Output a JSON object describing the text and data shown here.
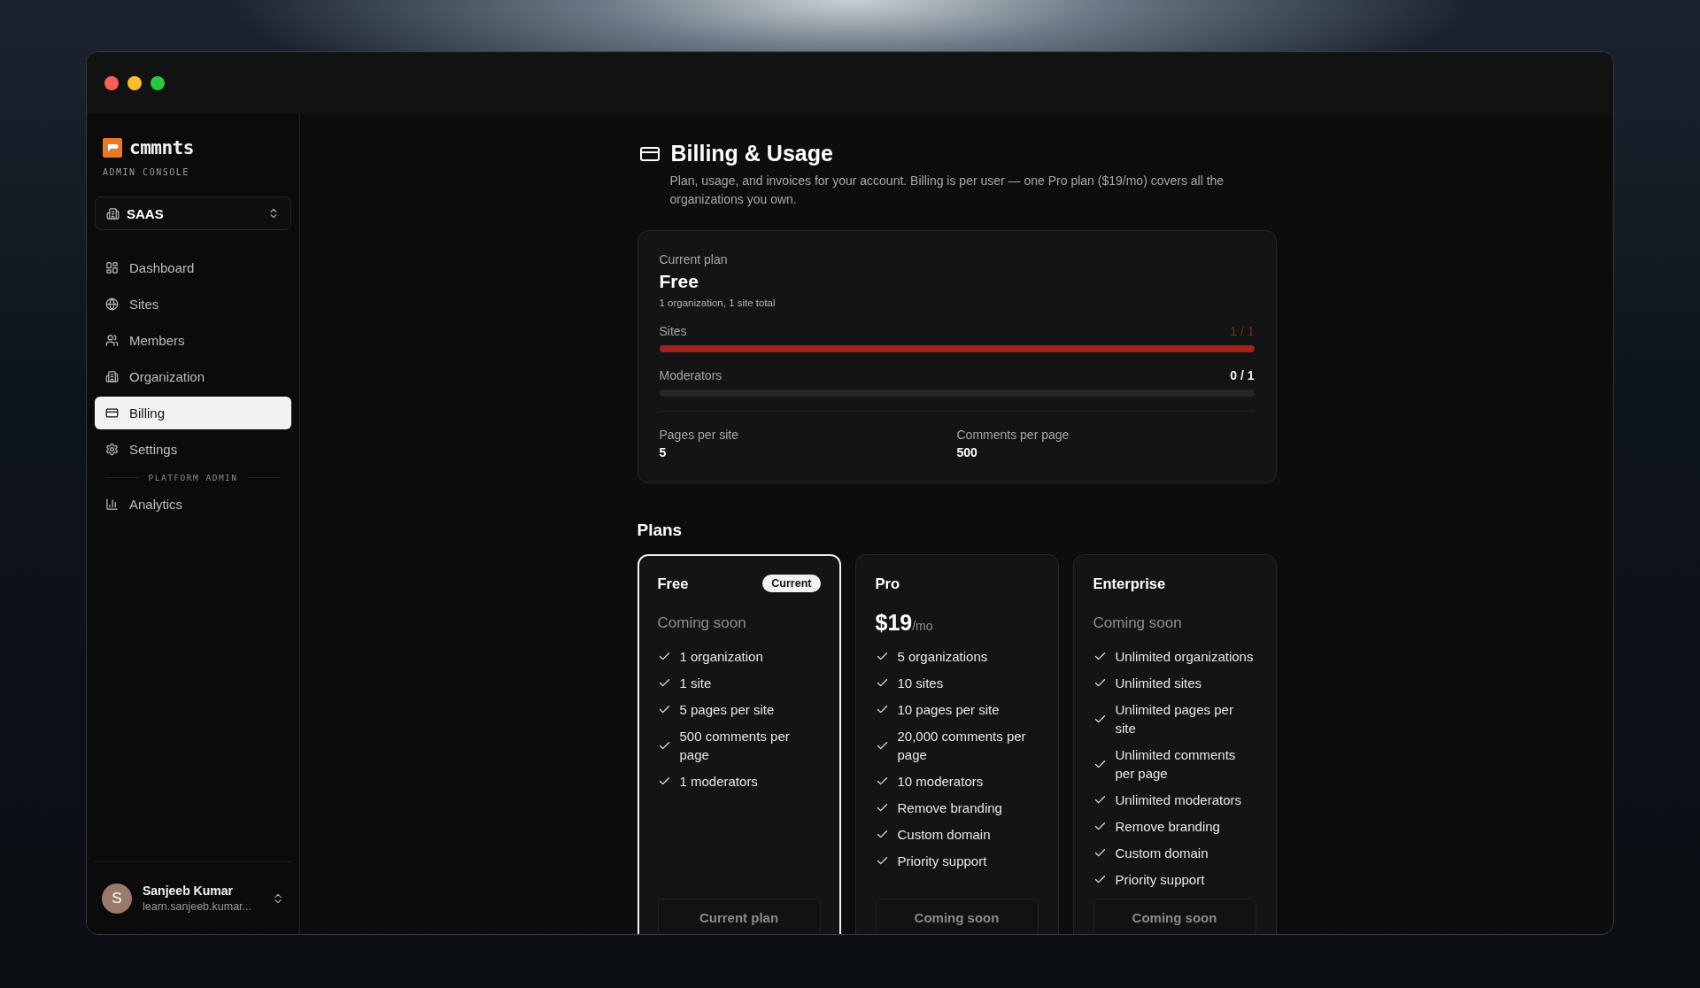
{
  "brand": {
    "name": "cmmnts",
    "subtitle": "ADMIN CONSOLE"
  },
  "org_switcher": {
    "value": "SAAS"
  },
  "sidebar": {
    "nav": [
      {
        "label": "Dashboard",
        "selected": false
      },
      {
        "label": "Sites",
        "selected": false
      },
      {
        "label": "Members",
        "selected": false
      },
      {
        "label": "Organization",
        "selected": false
      },
      {
        "label": "Billing",
        "selected": true
      },
      {
        "label": "Settings",
        "selected": false
      }
    ],
    "section": "PLATFORM ADMIN",
    "admin_nav": [
      {
        "label": "Analytics",
        "selected": false
      }
    ]
  },
  "user": {
    "initial": "S",
    "name": "Sanjeeb Kumar",
    "email": "learn.sanjeeb.kumar..."
  },
  "page": {
    "title": "Billing & Usage",
    "description": "Plan, usage, and invoices for your account. Billing is per user — one Pro plan ($19/mo) covers all the organizations you own."
  },
  "usage": {
    "label": "Current plan",
    "plan": "Free",
    "summary": "1 organization, 1 site total",
    "meters": [
      {
        "name": "Sites",
        "reading": "1 / 1",
        "level": 1,
        "at_limit": true
      },
      {
        "name": "Moderators",
        "reading": "0 / 1",
        "level": 0,
        "at_limit": false
      }
    ],
    "limits": [
      {
        "label": "Pages per site",
        "value": "5"
      },
      {
        "label": "Comments per page",
        "value": "500"
      }
    ]
  },
  "plans_title": "Plans",
  "plans": [
    {
      "name": "Free",
      "current": true,
      "badge": "Current",
      "price_note": "Coming soon",
      "features": [
        "1 organization",
        "1 site",
        "5 pages per site",
        "500 comments per page",
        "1 moderators"
      ],
      "button": {
        "label": "Current plan",
        "disabled": true
      }
    },
    {
      "name": "Pro",
      "current": false,
      "price": {
        "amount": "$19",
        "unit": "/mo"
      },
      "features": [
        "5 organizations",
        "10 sites",
        "10 pages per site",
        "20,000 comments per page",
        "10 moderators",
        "Remove branding",
        "Custom domain",
        "Priority support"
      ],
      "button": {
        "label": "Coming soon",
        "disabled": true
      }
    },
    {
      "name": "Enterprise",
      "current": false,
      "price_note": "Coming soon",
      "features": [
        "Unlimited organizations",
        "Unlimited sites",
        "Unlimited pages per site",
        "Unlimited comments per page",
        "Unlimited moderators",
        "Remove branding",
        "Custom domain",
        "Priority support"
      ],
      "button": {
        "label": "Coming soon",
        "disabled": true
      }
    }
  ]
}
